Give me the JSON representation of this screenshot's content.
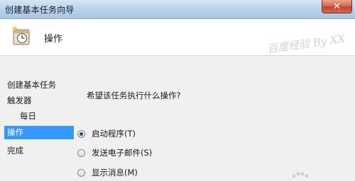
{
  "window": {
    "title": "创建基本任务向导",
    "close_symbol": "✕"
  },
  "header": {
    "title": "操作",
    "icon": "task-clock-icon",
    "watermark": "百度经验 By XX"
  },
  "sidebar": {
    "items": [
      {
        "label": "创建基本任务",
        "active": false
      },
      {
        "label": "触发器",
        "active": false
      },
      {
        "label": "每日",
        "active": false,
        "sub": true
      },
      {
        "label": "操作",
        "active": true
      },
      {
        "label": "完成",
        "active": false
      }
    ]
  },
  "main": {
    "question": "希望该任务执行什么操作?",
    "options": [
      {
        "label": "启动程序(T)",
        "checked": true
      },
      {
        "label": "发送电子邮件(S)",
        "checked": false
      },
      {
        "label": "显示消息(M)",
        "checked": false
      }
    ]
  },
  "colors": {
    "selection": "#3399ff",
    "titlebar": "#bcd4ec",
    "close_button": "#c3432d"
  }
}
